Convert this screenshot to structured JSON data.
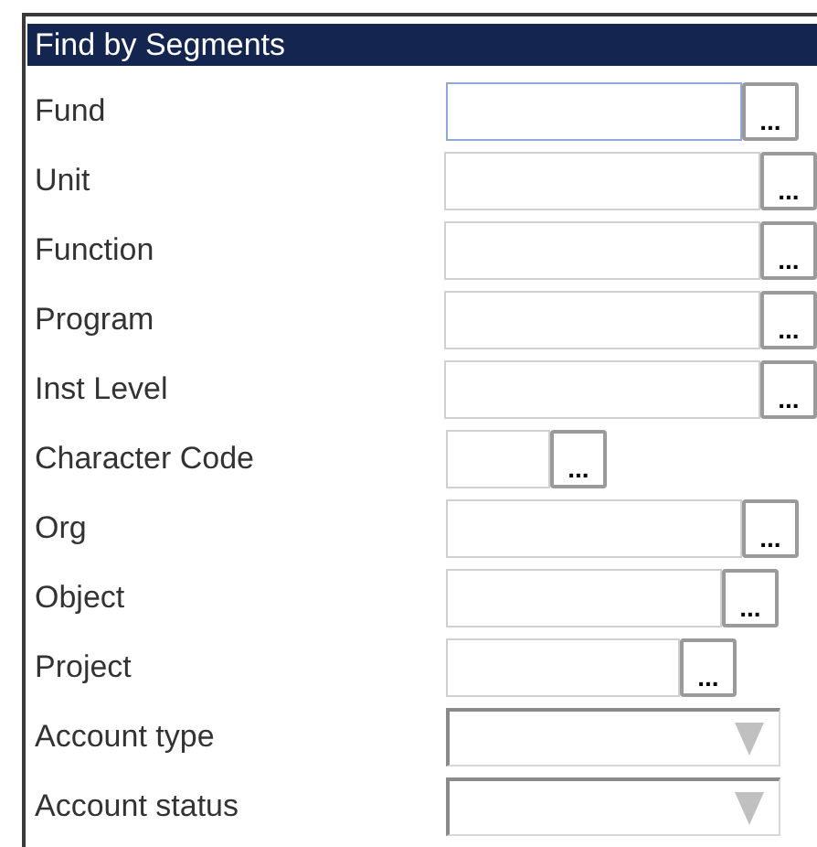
{
  "panel": {
    "title": "Find by Segments"
  },
  "fields": [
    {
      "label": "Fund",
      "kind": "lookup",
      "button": "...",
      "focused": true
    },
    {
      "label": "Unit",
      "kind": "lookup",
      "button": "...",
      "focused": false
    },
    {
      "label": "Function",
      "kind": "lookup",
      "button": "...",
      "focused": false
    },
    {
      "label": "Program",
      "kind": "lookup",
      "button": "...",
      "focused": false
    },
    {
      "label": "Inst Level",
      "kind": "lookup",
      "button": "...",
      "focused": false
    },
    {
      "label": "Character Code",
      "kind": "lookup",
      "button": "...",
      "focused": false
    },
    {
      "label": "Org",
      "kind": "lookup",
      "button": "...",
      "focused": false
    },
    {
      "label": "Object",
      "kind": "lookup",
      "button": "...",
      "focused": false
    },
    {
      "label": "Project",
      "kind": "lookup",
      "button": "...",
      "focused": false
    },
    {
      "label": "Account type",
      "kind": "dropdown",
      "disabled": true
    },
    {
      "label": "Account status",
      "kind": "dropdown",
      "disabled": true
    }
  ]
}
